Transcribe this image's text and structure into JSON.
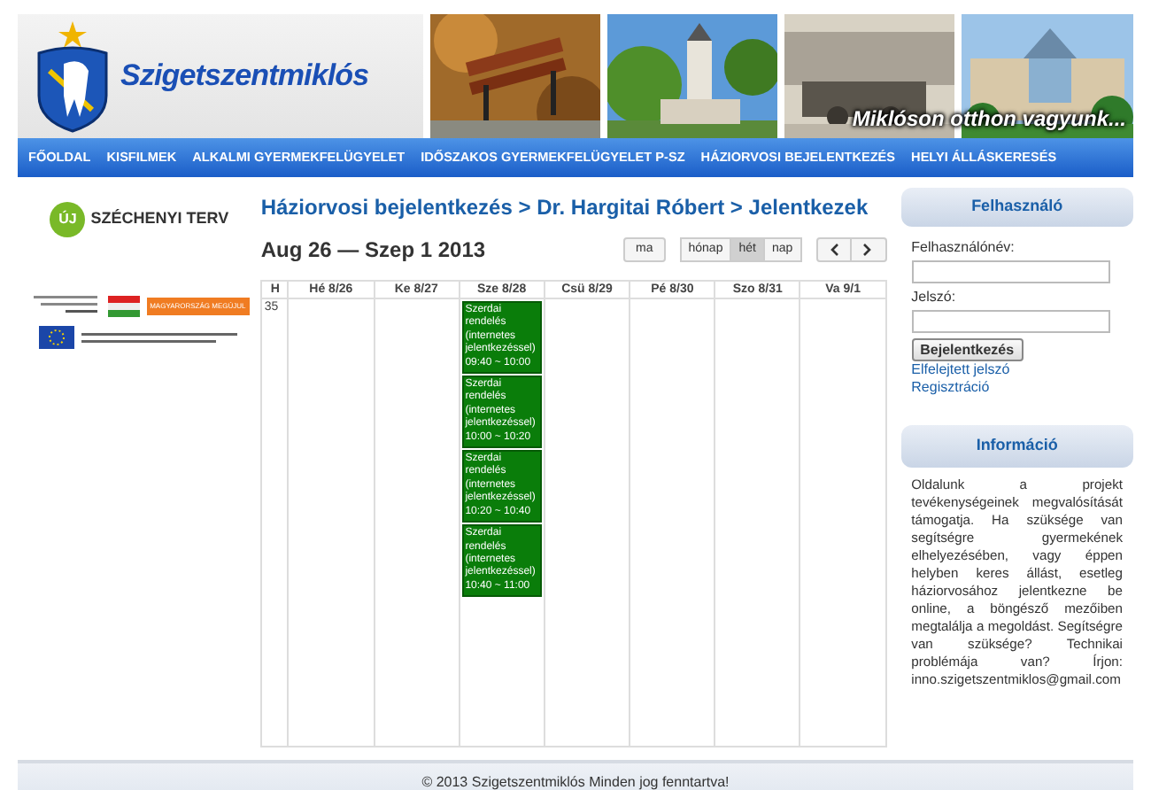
{
  "header": {
    "site_name": "Szigetszentmiklós",
    "slogan": "Miklóson otthon vagyunk...",
    "nav": [
      {
        "label": "FŐOLDAL"
      },
      {
        "label": "KISFILMEK"
      },
      {
        "label": "ALKALMI GYERMEKFELÜGYELET"
      },
      {
        "label": "IDŐSZAKOS GYERMEKFELÜGYELET P-SZ"
      },
      {
        "label": "HÁZIORVOSI BEJELENTKEZÉS"
      },
      {
        "label": "HELYI ÁLLÁSKERESÉS"
      }
    ]
  },
  "left": {
    "badge": "ÚJ",
    "brand": "SZÉCHENYI TERV",
    "eu_label": "MAGYARORSZÁG MEGÚJUL"
  },
  "calendar": {
    "breadcrumb": "Háziorvosi bejelentkezés > Dr. Hargitai Róbert > Jelentkezek",
    "date_range": "Aug 26 — Szep 1 2013",
    "today_button": "ma",
    "views": [
      {
        "label": "hónap",
        "selected": false
      },
      {
        "label": "hét",
        "selected": true
      },
      {
        "label": "nap",
        "selected": false
      }
    ],
    "week_header": "H",
    "week_number": "35",
    "days": [
      {
        "label": "Hé 8/26"
      },
      {
        "label": "Ke 8/27"
      },
      {
        "label": "Sze 8/28",
        "events": [
          {
            "title": "Szerdai rendelés (internetes jelentkezéssel)",
            "time": "09:40 ~ 10:00"
          },
          {
            "title": "Szerdai rendelés (internetes jelentkezéssel)",
            "time": "10:00 ~ 10:20"
          },
          {
            "title": "Szerdai rendelés (internetes jelentkezéssel)",
            "time": "10:20 ~ 10:40"
          },
          {
            "title": "Szerdai rendelés (internetes jelentkezéssel)",
            "time": "10:40 ~ 11:00"
          }
        ]
      },
      {
        "label": "Csü 8/29"
      },
      {
        "label": "Pé 8/30"
      },
      {
        "label": "Szo 8/31"
      },
      {
        "label": "Va 9/1"
      }
    ]
  },
  "sidebar": {
    "login_title": "Felhasználó",
    "username_label": "Felhasználónév:",
    "password_label": "Jelszó:",
    "login_button": "Bejelentkezés",
    "links": [
      "Elfelejtett jelszó",
      "Regisztráció"
    ],
    "info_title": "Információ",
    "info_text": "Oldalunk a projekt tevékenységeinek megvalósítását támogatja. Ha szüksége van segítségre gyermekének elhelyezésében, vagy éppen helyben keres állást, esetleg háziorvosához jelentkezne be online, a böngésző mezőiben megtalálja a megoldást. Segítségre van szüksége? Technikai problémája van? Írjon:",
    "info_email": "inno.szigetszentmiklos@gmail.com"
  },
  "footer": "© 2013 Szigetszentmiklós Minden jog fenntartva!"
}
